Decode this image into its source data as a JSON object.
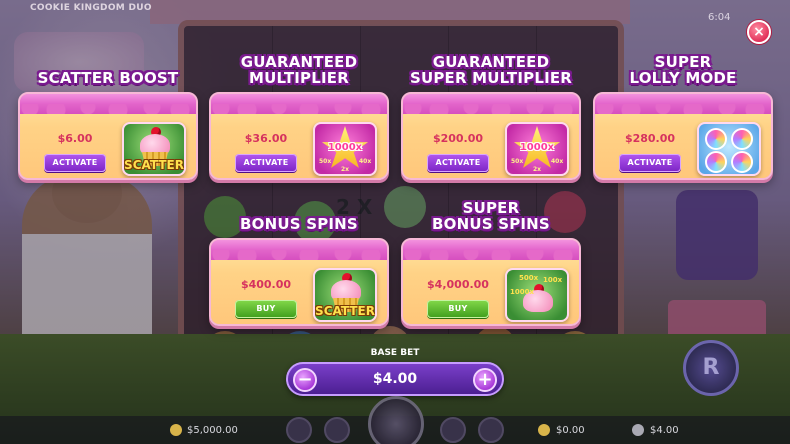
{
  "game": {
    "title": "COOKIE KINGDOM DUO",
    "time": "6:04",
    "multiplier_tag": "2 X"
  },
  "close_label": "×",
  "offers": [
    {
      "title_line1": "SCATTER BOOST",
      "title_line2": "",
      "price": "$6.00",
      "button": "ACTIVATE",
      "button_style": "purple",
      "art": "cupcake-scatter",
      "art_label": "SCATTER"
    },
    {
      "title_line1": "GUARANTEED",
      "title_line2": "MULTIPLIER",
      "price": "$36.00",
      "button": "ACTIVATE",
      "button_style": "purple",
      "art": "multiplier-star",
      "art_label": "1000x",
      "art_small": [
        "50x",
        "2x",
        "40x"
      ]
    },
    {
      "title_line1": "GUARANTEED",
      "title_line2": "SUPER MULTIPLIER",
      "price": "$200.00",
      "button": "ACTIVATE",
      "button_style": "purple",
      "art": "multiplier-star",
      "art_label": "1000x",
      "art_small": [
        "50x",
        "2x",
        "40x"
      ]
    },
    {
      "title_line1": "SUPER",
      "title_line2": "LOLLY MODE",
      "price": "$280.00",
      "button": "ACTIVATE",
      "button_style": "purple",
      "art": "lollipops"
    },
    {
      "title_line1": "BONUS SPINS",
      "title_line2": "",
      "price": "$400.00",
      "button": "BUY",
      "button_style": "green",
      "art": "cupcakes-scatter",
      "art_label": "SCATTER"
    },
    {
      "title_line1": "SUPER",
      "title_line2": "BONUS SPINS",
      "price": "$4,000.00",
      "button": "BUY",
      "button_style": "green",
      "art": "cupcake-multipliers",
      "art_small": [
        "500x",
        "100x",
        "1000x"
      ]
    }
  ],
  "bet": {
    "label": "BASE BET",
    "value": "$4.00",
    "minus": "−",
    "plus": "+"
  },
  "footer": {
    "balance": "$5,000.00",
    "win": "$0.00",
    "bet": "$4.00"
  },
  "colors": {
    "title_outline": "#7a1a8f",
    "price": "#d6325e",
    "activate_button": "#8f33d6",
    "buy_button": "#52b024",
    "bet_bar": "#5f2bb0"
  }
}
